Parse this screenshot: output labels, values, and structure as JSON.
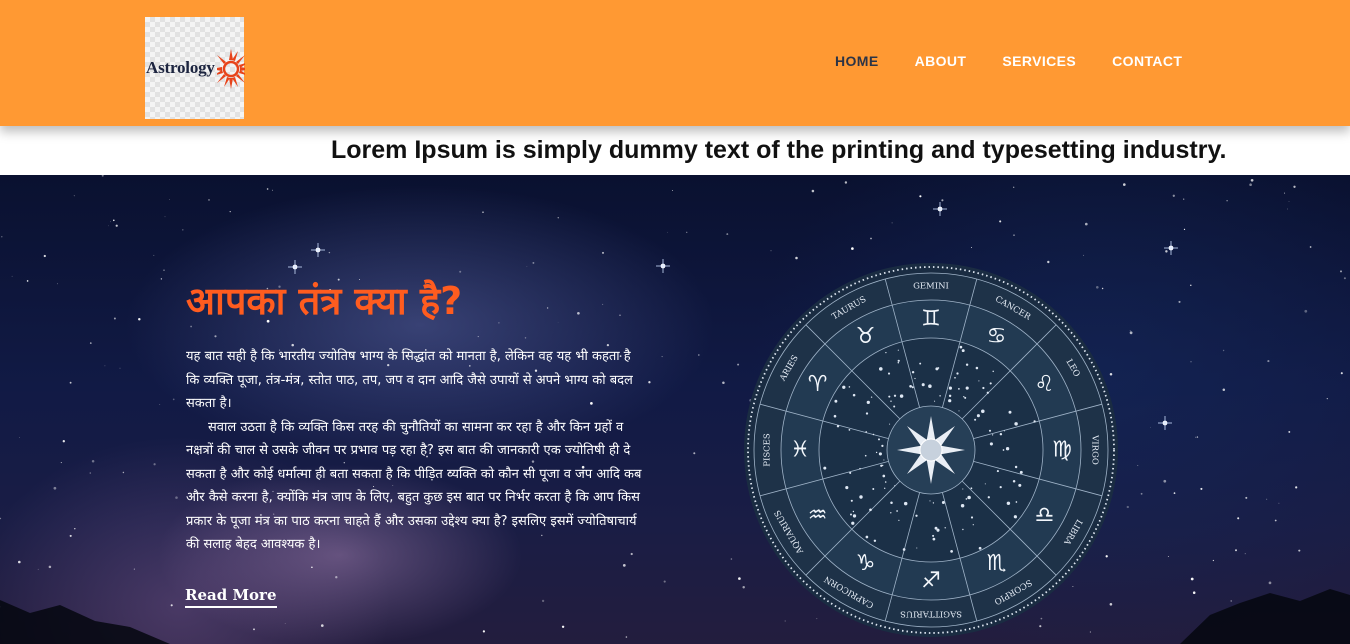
{
  "header": {
    "logo_text": "Astrology",
    "bg_color": "#ff9933",
    "nav": [
      {
        "label": "HOME",
        "active": true
      },
      {
        "label": "ABOUT",
        "active": false
      },
      {
        "label": "SERVICES",
        "active": false
      },
      {
        "label": "CONTACT",
        "active": false
      }
    ]
  },
  "ticker": {
    "text": "Lorem Ipsum is simply dummy text of the printing and typesetting industry."
  },
  "hero": {
    "title": "आपका तंत्र क्या है?",
    "title_color": "#ff5c1f",
    "paragraph_1": "यह बात सही है कि भारतीय ज्योतिष भाग्य के सिद्धांत को मानता है, लेकिन वह यह भी कहता है कि व्यक्ति पूजा, तंत्र-मंत्र, स्तोत पाठ, तप, जप व दान आदि जैसे उपायों से अपने भाग्य को बदल सकता है।",
    "paragraph_2": "सवाल उठता है कि व्यक्ति किस तरह की चुनौतियों का सामना कर रहा है और किन ग्रहों व नक्षत्रों की चाल से उसके जीवन पर प्रभाव पड़ रहा है? इस बात की जानकारी एक ज्योतिषी ही दे सकता है और कोई धर्मात्मा ही बता सकता है कि पीड़ित व्यक्ति को कौन सी पूजा व जप आदि कब और कैसे करना है, क्योंकि मंत्र जाप के लिए, बहुत कुछ इस बात पर निर्भर करता है कि आप किस प्रकार के पूजा मंत्र का पाठ करना चाहते हैं और उसका उद्देश्य क्या है? इसलिए इसमें ज्योतिषाचार्य की सलाह बेहद आवश्यक है।",
    "read_more": "Read More"
  },
  "zodiac_wheel": {
    "signs": [
      {
        "name": "GEMINI",
        "glyph": "♊"
      },
      {
        "name": "CANCER",
        "glyph": "♋"
      },
      {
        "name": "LEO",
        "glyph": "♌"
      },
      {
        "name": "VIRGO",
        "glyph": "♍"
      },
      {
        "name": "LIBRA",
        "glyph": "♎"
      },
      {
        "name": "SCORPIO",
        "glyph": "♏"
      },
      {
        "name": "SAGITTARIUS",
        "glyph": "♐"
      },
      {
        "name": "CAPRICORN",
        "glyph": "♑"
      },
      {
        "name": "AQUARIUS",
        "glyph": "♒"
      },
      {
        "name": "PISCES",
        "glyph": "♓"
      },
      {
        "name": "ARIES",
        "glyph": "♈"
      },
      {
        "name": "TAURUS",
        "glyph": "♉"
      }
    ]
  }
}
